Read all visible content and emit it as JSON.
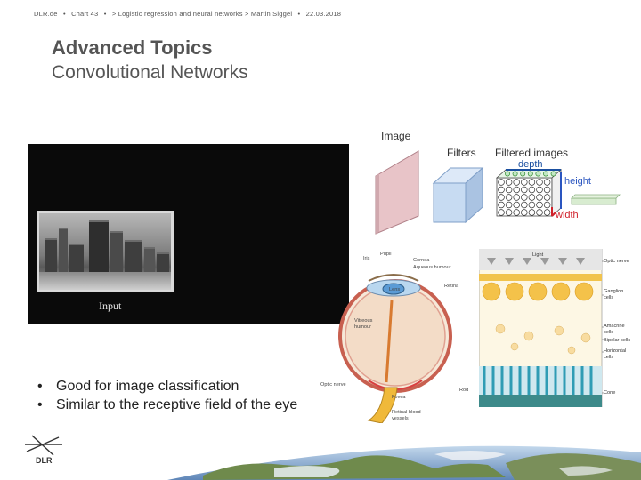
{
  "header": {
    "site": "DLR.de",
    "sep1": "•",
    "chart": "Chart 43",
    "sep2": "•",
    "presentation": "> Logistic regression and neural networks > Martin Siggel",
    "sep3": "•",
    "date": "22.03.2018"
  },
  "title": {
    "main": "Advanced Topics",
    "sub": "Convolutional Networks"
  },
  "photo": {
    "caption": "Input"
  },
  "filters_diagram": {
    "image_label": "Image",
    "filters_label": "Filters",
    "filtered_label": "Filtered images",
    "depth_label": "depth",
    "height_label": "height",
    "width_label": "width"
  },
  "eye_diagram": {
    "labels": {
      "iris": "Iris",
      "pupil": "Pupil",
      "cornea": "Cornea",
      "aqueous": "Aqueous humour",
      "lens": "Lens",
      "retina": "Retina",
      "vitreous": "Vitreous humour",
      "optic_nerve": "Optic nerve",
      "fovea": "Fovea",
      "retinal_vessels": "Retinal blood vessels"
    }
  },
  "retina_diagram": {
    "labels": {
      "light": "Light",
      "optic_nerve": "Optic nerve",
      "ganglion": "Ganglion cells",
      "amacrine": "Amacrine cells",
      "bipolar": "Bipolar cells",
      "horizontal": "Horizontal cells",
      "rod": "Rod",
      "cone": "Cone"
    }
  },
  "bullets": [
    "Good for image classification",
    "Similar to the receptive field of the eye"
  ],
  "logo": {
    "text": "DLR"
  },
  "colors": {
    "title": "#555555",
    "depth": "#1a4fa0",
    "height": "#2a55c0",
    "width": "#d0202a"
  }
}
